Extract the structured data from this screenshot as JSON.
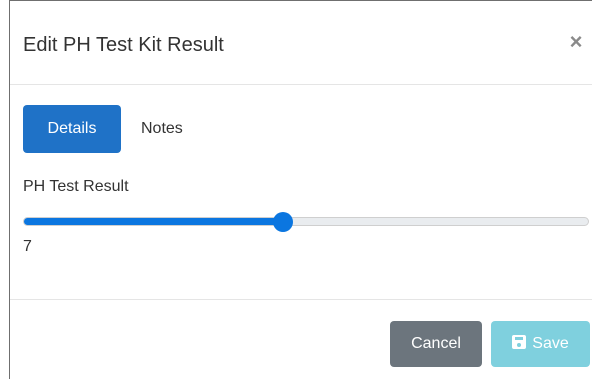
{
  "dialog": {
    "title": "Edit PH Test Kit Result",
    "close_symbol": "×"
  },
  "tabs": [
    {
      "label": "Details",
      "active": true
    },
    {
      "label": "Notes",
      "active": false
    }
  ],
  "ph_field": {
    "label": "PH Test Result",
    "value": "7",
    "level_fraction": 0.46
  },
  "footer": {
    "cancel_label": "Cancel",
    "save_label": "Save"
  },
  "colors": {
    "primary": "#1f72c7",
    "slider": "#0b76e0",
    "cancel": "#6c757d",
    "save": "#7fd0de"
  },
  "icons": {
    "close": "close-icon",
    "save": "floppy-disk-icon"
  }
}
